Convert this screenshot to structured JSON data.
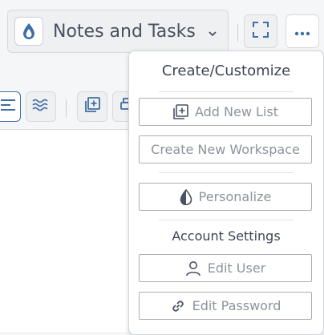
{
  "header": {
    "workspace_title": "Notes and Tasks",
    "icons": {
      "logo": "drop-icon",
      "dropdown": "chevron-down-icon",
      "fullscreen": "fullscreen-icon",
      "more": "more-horizontal-icon"
    }
  },
  "toolbar": {
    "icons": [
      "align-left-icon",
      "waves-icon",
      "add-list-icon",
      "print-icon"
    ]
  },
  "menu": {
    "section1_heading": "Create/Customize",
    "add_new_list": "Add New List",
    "create_new_workspace": "Create New Workspace",
    "personalize": "Personalize",
    "section2_heading": "Account Settings",
    "edit_user": "Edit User",
    "edit_password": "Edit Password"
  },
  "colors": {
    "accent": "#3f6ea3",
    "muted_text": "#8d939c",
    "border": "#a9aeb6"
  }
}
